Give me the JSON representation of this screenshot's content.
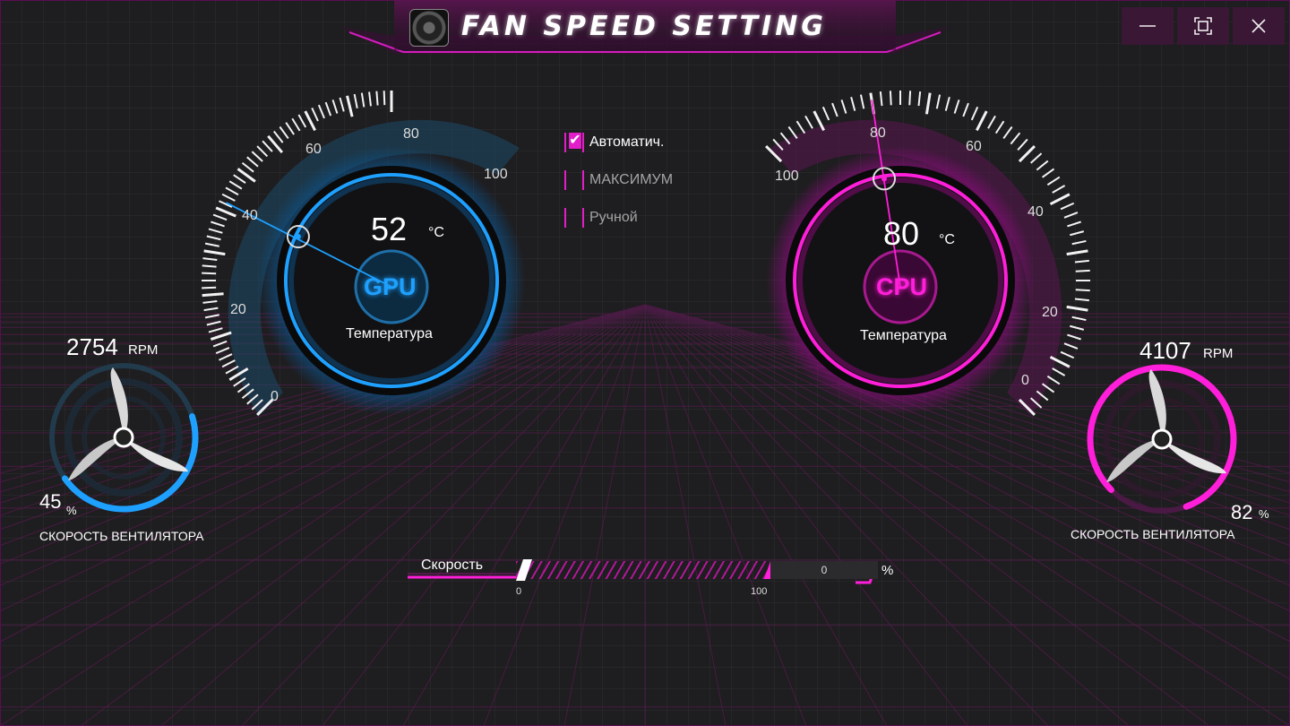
{
  "window": {
    "title": "FAN SPEED SETTING",
    "minimize_icon": "minimize-icon",
    "maximize_icon": "maximize-icon",
    "close_icon": "close-icon"
  },
  "gpu": {
    "chip": "GPU",
    "temperature": "52",
    "unit": "°C",
    "label": "Температура",
    "scale": [
      "0",
      "20",
      "40",
      "60",
      "80",
      "100"
    ],
    "needle_value": 52,
    "color": "#1ea0ff"
  },
  "cpu": {
    "chip": "CPU",
    "temperature": "80",
    "unit": "°C",
    "label": "Температура",
    "scale": [
      "0",
      "20",
      "40",
      "60",
      "80",
      "100"
    ],
    "needle_value": 80,
    "color": "#ff1ed9"
  },
  "modes": [
    {
      "label": "Автоматич.",
      "checked": true
    },
    {
      "label": "МАКСИМУМ",
      "checked": false
    },
    {
      "label": "Ручной",
      "checked": false
    }
  ],
  "left_fan": {
    "rpm": "2754",
    "rpm_unit": "RPM",
    "percent": "45",
    "percent_unit": "%",
    "label": "СКОРОСТЬ ВЕНТИЛЯТОРА",
    "fraction": 0.45
  },
  "right_fan": {
    "rpm": "4107",
    "rpm_unit": "RPM",
    "percent": "82",
    "percent_unit": "%",
    "label": "СКОРОСТЬ ВЕНТИЛЯТОРА",
    "fraction": 0.82
  },
  "speed": {
    "label": "Скорость",
    "value": "0",
    "unit": "%",
    "min": "0",
    "max": "100"
  }
}
